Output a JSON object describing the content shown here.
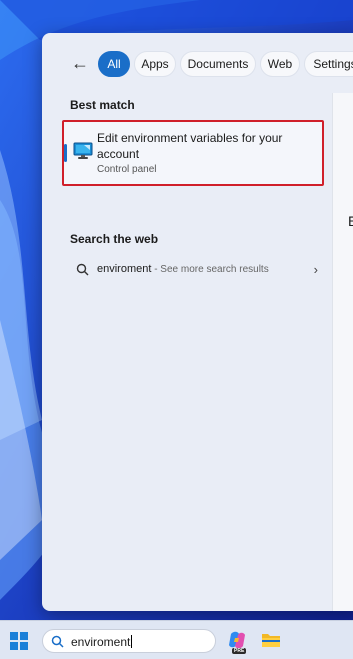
{
  "filters": {
    "back_icon": "arrow-left-icon",
    "tabs": [
      {
        "label": "All",
        "active": true
      },
      {
        "label": "Apps",
        "active": false
      },
      {
        "label": "Documents",
        "active": false
      },
      {
        "label": "Web",
        "active": false
      },
      {
        "label": "Settings",
        "active": false
      }
    ]
  },
  "best_match": {
    "heading": "Best match",
    "title": "Edit environment variables for your account",
    "subtitle": "Control panel",
    "icon": "monitor-settings-icon"
  },
  "web": {
    "heading": "Search the web",
    "term": "enviroment",
    "more": " - See more search results",
    "chevron": "›"
  },
  "preview": {
    "letter": "E"
  },
  "taskbar": {
    "search_value": "enviroment",
    "copilot_badge": "PRE"
  },
  "colors": {
    "accent": "#1a6ec8",
    "highlight_border": "#d01f2a",
    "panel_bg": "#e9edf6",
    "wallpaper": "#1f4fd1"
  }
}
